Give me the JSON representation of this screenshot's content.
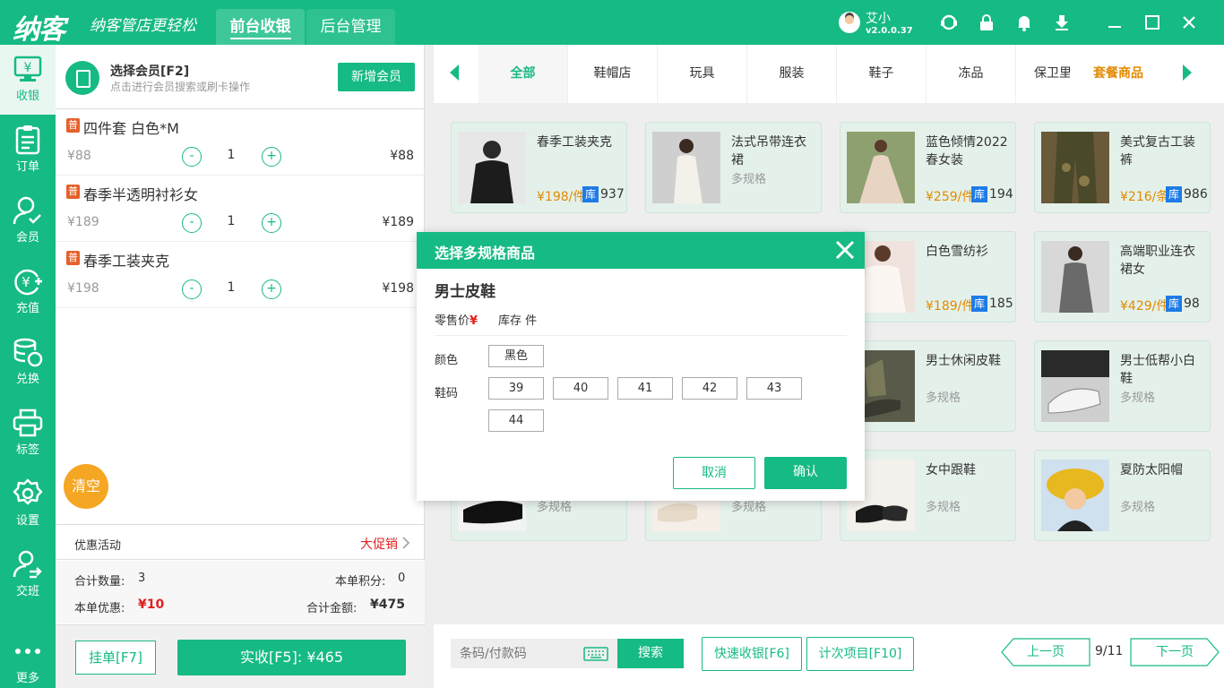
{
  "topbar": {
    "logo": "纳客",
    "slogan": "纳客管店更轻松",
    "tabs": [
      {
        "label": "前台收银"
      },
      {
        "label": "后台管理"
      }
    ],
    "user": {
      "name": "艾小",
      "version": "v2.0.0.37"
    }
  },
  "sidebar": {
    "items": [
      {
        "label": "收银",
        "icon": "cashier-icon"
      },
      {
        "label": "订单",
        "icon": "order-icon"
      },
      {
        "label": "会员",
        "icon": "member-icon"
      },
      {
        "label": "充值",
        "icon": "recharge-icon"
      },
      {
        "label": "兑换",
        "icon": "exchange-icon"
      },
      {
        "label": "标签",
        "icon": "printer-icon"
      },
      {
        "label": "设置",
        "icon": "gear-icon"
      },
      {
        "label": "交班",
        "icon": "shift-icon"
      },
      {
        "label": "更多",
        "icon": "more-icon"
      }
    ]
  },
  "member": {
    "title": "选择会员[F2]",
    "hint": "点击进行会员搜索或刷卡操作",
    "add_label": "新增会员"
  },
  "cart": {
    "badge": "普",
    "items": [
      {
        "name": "四件套 白色*M",
        "price": "¥88",
        "qty": "1",
        "subtotal": "¥88"
      },
      {
        "name": "春季半透明衬衫女",
        "price": "¥189",
        "qty": "1",
        "subtotal": "¥189"
      },
      {
        "name": "春季工装夹克",
        "price": "¥198",
        "qty": "1",
        "subtotal": "¥198"
      }
    ],
    "minus": "-",
    "plus": "+",
    "clear_label": "清空",
    "promo_label": "优惠活动",
    "promo_value": "大促销",
    "total_qty_label": "合计数量:",
    "total_qty": "3",
    "points_label": "本单积分:",
    "points": "0",
    "discount_label": "本单优惠:",
    "discount": "¥10",
    "amount_label": "合计金额:",
    "amount": "¥475",
    "hold_label": "挂单[F7]",
    "pay_label": "实收[F5]: ¥465"
  },
  "categories": {
    "items": [
      "全部",
      "鞋帽店",
      "玩具",
      "服装",
      "鞋子",
      "冻品",
      "保卫里脊"
    ],
    "combo": "套餐商品"
  },
  "products": [
    {
      "name": "春季工装夹克",
      "price": "¥198/件",
      "stock_badge": "库",
      "stock": "937"
    },
    {
      "name": "法式吊带连衣裙",
      "spec": "多规格"
    },
    {
      "name": "蓝色倾情2022春女装",
      "price": "¥259/件",
      "stock_badge": "库",
      "stock": "194"
    },
    {
      "name": "美式复古工装裤",
      "price": "¥216/条",
      "stock_badge": "库",
      "stock": "986"
    },
    {
      "name": "白色雪纺衫",
      "price": "¥189/件",
      "stock_badge": "库",
      "stock": "185"
    },
    {
      "name": "高端职业连衣裙女",
      "price": "¥429/件",
      "stock_badge": "库",
      "stock": "98"
    },
    {
      "name": "男士休闲皮鞋",
      "spec": "多规格"
    },
    {
      "name": "男士低帮小白鞋",
      "spec": "多规格"
    },
    {
      "spec": "多规格"
    },
    {
      "spec": "多规格"
    },
    {
      "name": "女中跟鞋",
      "spec": "多规格"
    },
    {
      "name": "夏防太阳帽",
      "spec": "多规格"
    }
  ],
  "bottom": {
    "search_placeholder": "条码/付款码",
    "search_label": "搜索",
    "quick_label": "快速收银[F6]",
    "count_label": "计次项目[F10]",
    "prev_label": "上一页",
    "page": "9/11",
    "next_label": "下一页"
  },
  "dialog": {
    "title": "选择多规格商品",
    "product_name": "男士皮鞋",
    "price_label": "零售价",
    "currency": "¥",
    "stock_label": "库存 件",
    "color_label": "颜色",
    "colors": [
      "黑色"
    ],
    "size_label": "鞋码",
    "sizes": [
      "39",
      "40",
      "41",
      "42",
      "43",
      "44"
    ],
    "cancel_label": "取消",
    "confirm_label": "确认"
  },
  "colors": {
    "brand": "#16ba84",
    "price": "#e28a00",
    "danger": "#e02020",
    "stock_badge": "#1e7be6"
  }
}
